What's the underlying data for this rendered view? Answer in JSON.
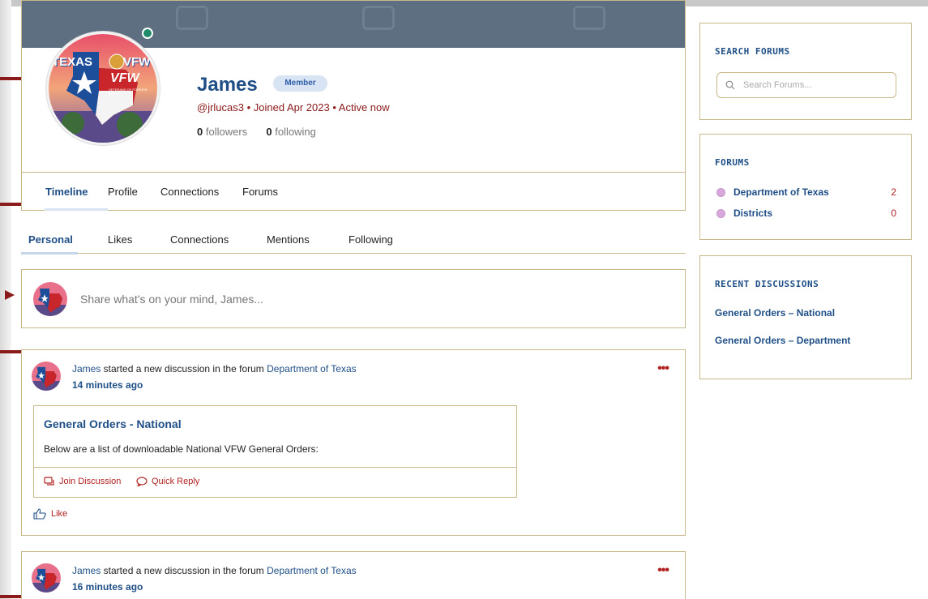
{
  "profile": {
    "name": "James",
    "badge": "Member",
    "meta": "@jrlucas3 • Joined Apr 2023 • Active now",
    "followers_count": "0",
    "followers_label": "followers",
    "following_count": "0",
    "following_label": "following",
    "avatar_text_top": "TEXAS",
    "avatar_text_right": "VFW",
    "avatar_text_center": "VFW",
    "avatar_caption": "VETERANS OF FOREIGN WARS"
  },
  "profile_tabs": [
    {
      "label": "Timeline",
      "active": true
    },
    {
      "label": "Profile",
      "active": false
    },
    {
      "label": "Connections",
      "active": false
    },
    {
      "label": "Forums",
      "active": false
    }
  ],
  "sub_tabs": [
    {
      "label": "Personal",
      "active": true
    },
    {
      "label": "Likes",
      "active": false
    },
    {
      "label": "Connections",
      "active": false
    },
    {
      "label": "Mentions",
      "active": false
    },
    {
      "label": "Following",
      "active": false
    }
  ],
  "share": {
    "placeholder": "Share what's on your mind, James..."
  },
  "activity": [
    {
      "user": "James",
      "action": " started a new discussion in the forum ",
      "forum": "Department of Texas",
      "time": "14 minutes ago",
      "more": "•••",
      "discussion_title": "General Orders - National",
      "discussion_body": "Below are a list of downloadable National VFW General Orders:",
      "join_label": "Join Discussion",
      "reply_label": "Quick Reply",
      "like_label": "Like"
    },
    {
      "user": "James",
      "action": " started a new discussion in the forum ",
      "forum": "Department of Texas",
      "time": "16 minutes ago",
      "more": "•••"
    }
  ],
  "sidebar": {
    "search_title": "SEARCH FORUMS",
    "search_placeholder": "Search Forums...",
    "forums_title": "FORUMS",
    "forums": [
      {
        "name": "Department of Texas",
        "count": "2"
      },
      {
        "name": "Districts",
        "count": "0"
      }
    ],
    "recent_title": "RECENT DISCUSSIONS",
    "recent": [
      {
        "title": "General Orders – National"
      },
      {
        "title": "General Orders – Department"
      }
    ]
  },
  "colors": {
    "accent_blue": "#1f4f86",
    "accent_red": "#b22222",
    "border_gold": "#c8b98a",
    "cover_gray": "#5d6f80"
  }
}
